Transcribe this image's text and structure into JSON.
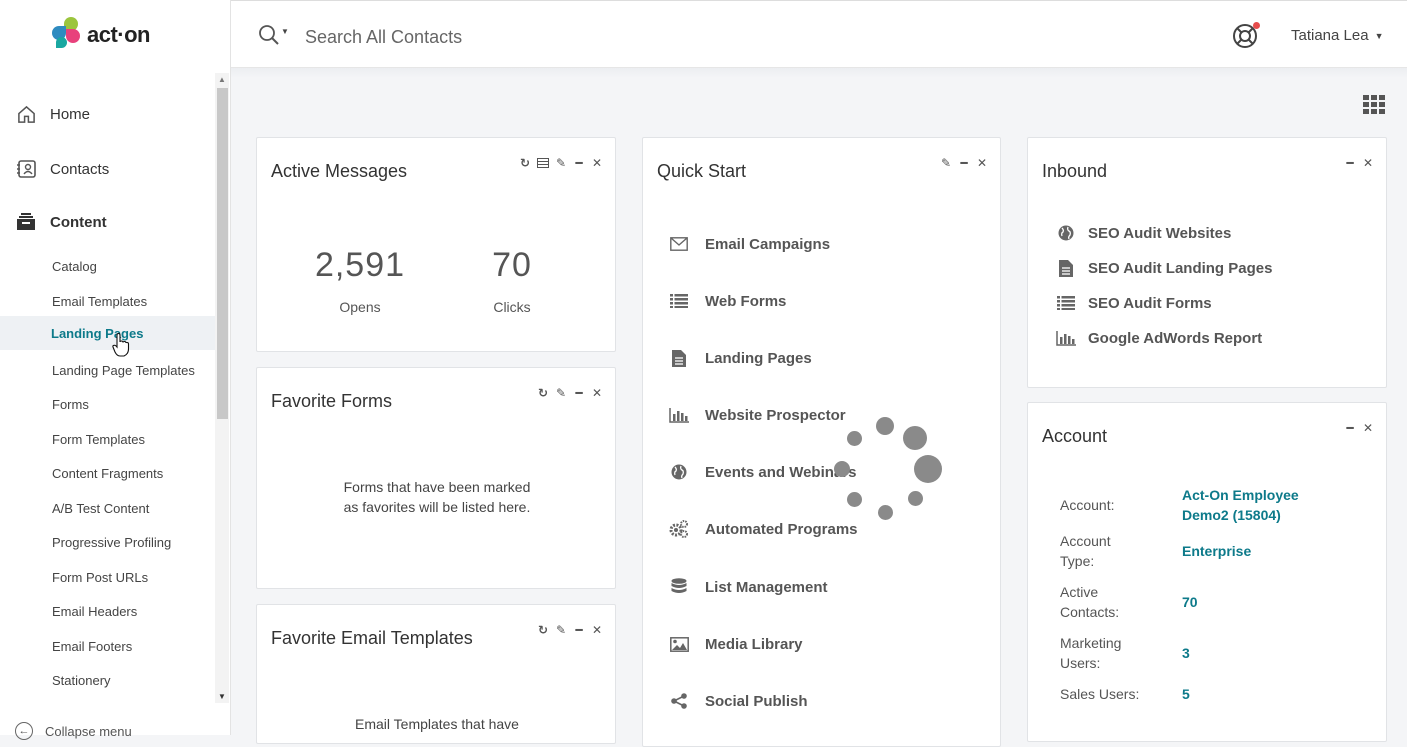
{
  "brand": {
    "name": "act·on"
  },
  "sidebar": {
    "main_items": [
      {
        "label": "Home",
        "icon": "home-icon"
      },
      {
        "label": "Contacts",
        "icon": "contacts-icon"
      },
      {
        "label": "Content",
        "icon": "content-icon"
      }
    ],
    "sub_items": [
      {
        "label": "Catalog"
      },
      {
        "label": "Email Templates"
      },
      {
        "label": "Landing Pages",
        "active": true
      },
      {
        "label": "Landing Page Templates"
      },
      {
        "label": "Forms"
      },
      {
        "label": "Form Templates"
      },
      {
        "label": "Content Fragments"
      },
      {
        "label": "A/B Test Content"
      },
      {
        "label": "Progressive Profiling"
      },
      {
        "label": "Form Post URLs"
      },
      {
        "label": "Email Headers"
      },
      {
        "label": "Email Footers"
      },
      {
        "label": "Stationery"
      }
    ],
    "collapse_label": "Collapse menu"
  },
  "header": {
    "search_placeholder": "Search All Contacts",
    "user_name": "Tatiana Lea"
  },
  "active_messages": {
    "title": "Active Messages",
    "opens_value": "2,591",
    "opens_label": "Opens",
    "clicks_value": "70",
    "clicks_label": "Clicks"
  },
  "favorite_forms": {
    "title": "Favorite Forms",
    "empty_text": "Forms that have been marked as favorites will be listed here."
  },
  "favorite_email_templates": {
    "title": "Favorite Email Templates",
    "empty_text": "Email Templates that have"
  },
  "quick_start": {
    "title": "Quick Start",
    "items": [
      {
        "label": "Email Campaigns",
        "icon": "envelope-icon"
      },
      {
        "label": "Web Forms",
        "icon": "list-icon"
      },
      {
        "label": "Landing Pages",
        "icon": "document-icon"
      },
      {
        "label": "Website Prospector",
        "icon": "bar-chart-icon"
      },
      {
        "label": "Events and Webinars",
        "icon": "globe-icon"
      },
      {
        "label": "Automated Programs",
        "icon": "gears-icon"
      },
      {
        "label": "List Management",
        "icon": "database-icon"
      },
      {
        "label": "Media Library",
        "icon": "image-icon"
      },
      {
        "label": "Social Publish",
        "icon": "share-icon"
      }
    ]
  },
  "inbound": {
    "title": "Inbound",
    "items": [
      {
        "label": "SEO Audit Websites",
        "icon": "globe-icon"
      },
      {
        "label": "SEO Audit Landing Pages",
        "icon": "document-icon"
      },
      {
        "label": "SEO Audit Forms",
        "icon": "list-icon"
      },
      {
        "label": "Google AdWords Report",
        "icon": "bar-chart-icon"
      }
    ]
  },
  "account": {
    "title": "Account",
    "rows": [
      {
        "key": "Account:",
        "value": "Act-On Employee Demo2 (15804)"
      },
      {
        "key": "Account Type:",
        "value": "Enterprise"
      },
      {
        "key": "Active Contacts:",
        "value": "70"
      },
      {
        "key": "Marketing Users:",
        "value": "3"
      },
      {
        "key": "Sales Users:",
        "value": "5"
      }
    ]
  },
  "colors": {
    "accent": "#0d7a8a",
    "spinner": "#8a8a8a"
  }
}
